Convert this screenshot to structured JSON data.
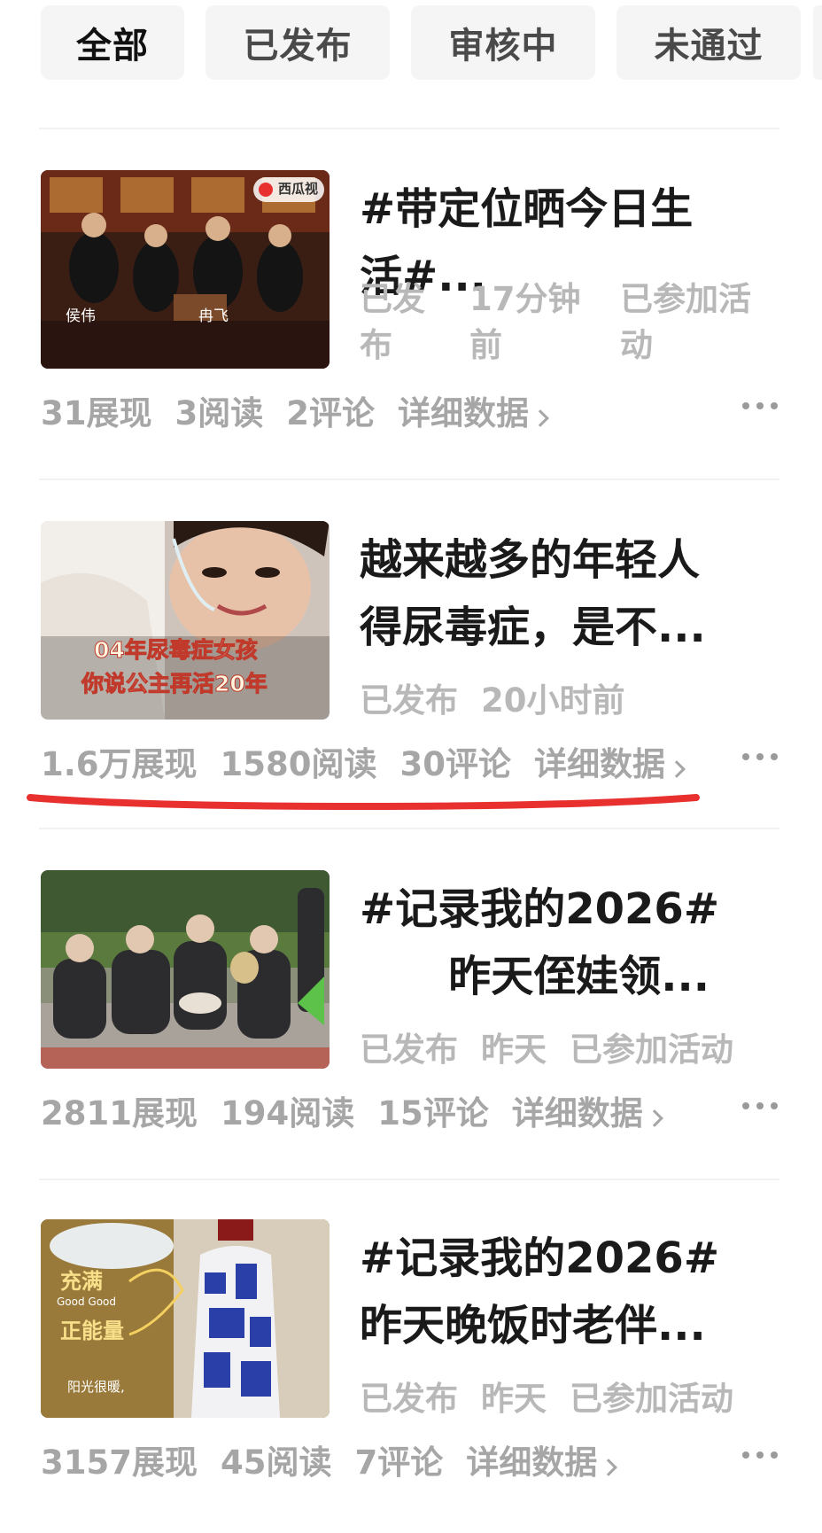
{
  "tabs": [
    {
      "label": "全部",
      "active": true
    },
    {
      "label": "已发布",
      "active": false
    },
    {
      "label": "审核中",
      "active": false
    },
    {
      "label": "未通过",
      "active": false
    }
  ],
  "posts": [
    {
      "title_lines": [
        "#带定位晒今日生",
        "活#..."
      ],
      "meta_lines": [
        [
          "已发",
          "17分钟",
          "已参加活"
        ],
        [
          "布",
          "前",
          "动"
        ]
      ],
      "stats": [
        "31展现",
        "3阅读",
        "2评论"
      ],
      "detail_label": "详细数据",
      "thumb_icon": "orchestra-photo",
      "thumb_texts": {
        "badge": "西瓜视",
        "left": "侯伟",
        "right": "冉飞"
      }
    },
    {
      "title_lines": [
        "越来越多的年轻人",
        "得尿毒症，是不..."
      ],
      "meta": [
        "已发布",
        "20小时前"
      ],
      "stats": [
        "1.6万展现",
        "1580阅读",
        "30评论"
      ],
      "detail_label": "详细数据",
      "thumb_icon": "girl-with-nasal-tube-photo",
      "thumb_texts": {
        "line1": "04年尿毒症女孩",
        "line2": "你说公主再活20年"
      }
    },
    {
      "title_lines": [
        "#记录我的2026#",
        "      昨天侄娃领..."
      ],
      "meta": [
        "已发布",
        "昨天",
        "已参加活动"
      ],
      "stats": [
        "2811展现",
        "194阅读",
        "15评论"
      ],
      "detail_label": "详细数据",
      "thumb_icon": "elderly-musicians-photo"
    },
    {
      "title_lines": [
        "#记录我的2026#",
        "昨天晚饭时老伴..."
      ],
      "meta": [
        "已发布",
        "昨天",
        "已参加活动"
      ],
      "stats": [
        "3157展现",
        "45阅读",
        "7评论"
      ],
      "detail_label": "详细数据",
      "thumb_icon": "liquor-bottle-photo",
      "thumb_texts": {
        "line1": "充满",
        "line2": "Good Good",
        "line3": "正能量",
        "line4": "阳光很暖,"
      }
    }
  ],
  "highlight_color": "#e8302f"
}
